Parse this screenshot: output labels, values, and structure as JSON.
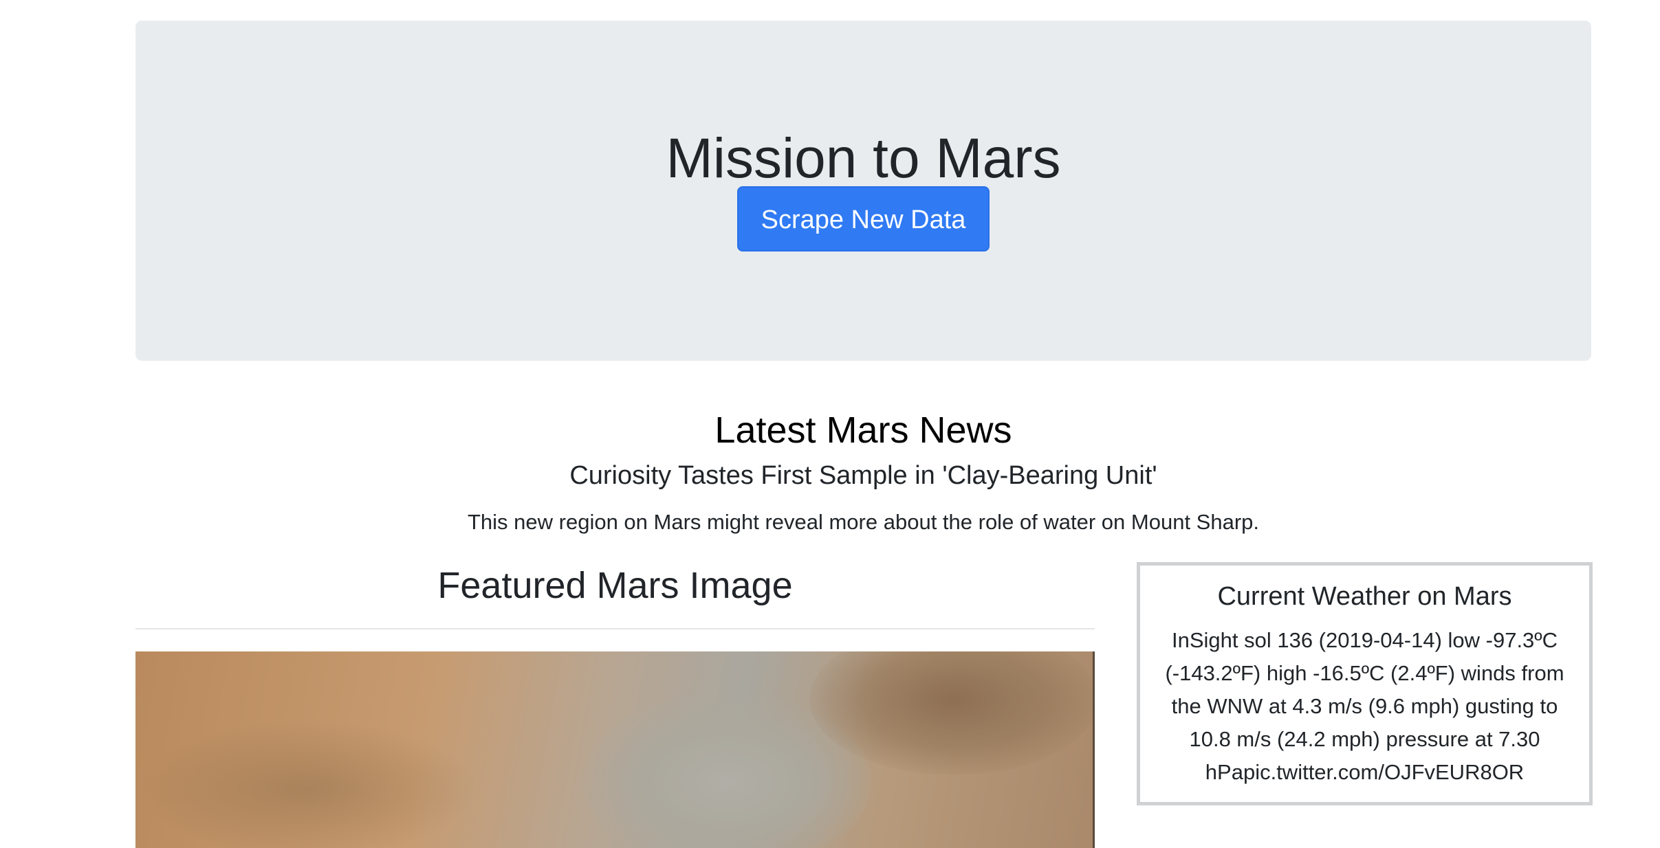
{
  "header": {
    "title": "Mission to Mars",
    "scrape_button_label": "Scrape New Data"
  },
  "news": {
    "heading": "Latest Mars News",
    "title": "Curiosity Tastes First Sample in 'Clay-Bearing Unit'",
    "teaser": "This new region on Mars might reveal more about the role of water on Mount Sharp."
  },
  "featured_image": {
    "heading": "Featured Mars Image"
  },
  "weather": {
    "heading": "Current Weather on Mars",
    "text": "InSight sol 136 (2019-04-14) low -97.3ºC (-143.2ºF) high -16.5ºC (2.4ºF) winds from the WNW at 4.3 m/s (9.6 mph) gusting to 10.8 m/s (24.2 mph) pressure at 7.30 hPapic.twitter.com/OJFvEUR8OR"
  },
  "colors": {
    "jumbotron_bg": "#e9ecef",
    "button_primary": "#307bf4",
    "weather_border": "#cfd1d3"
  }
}
